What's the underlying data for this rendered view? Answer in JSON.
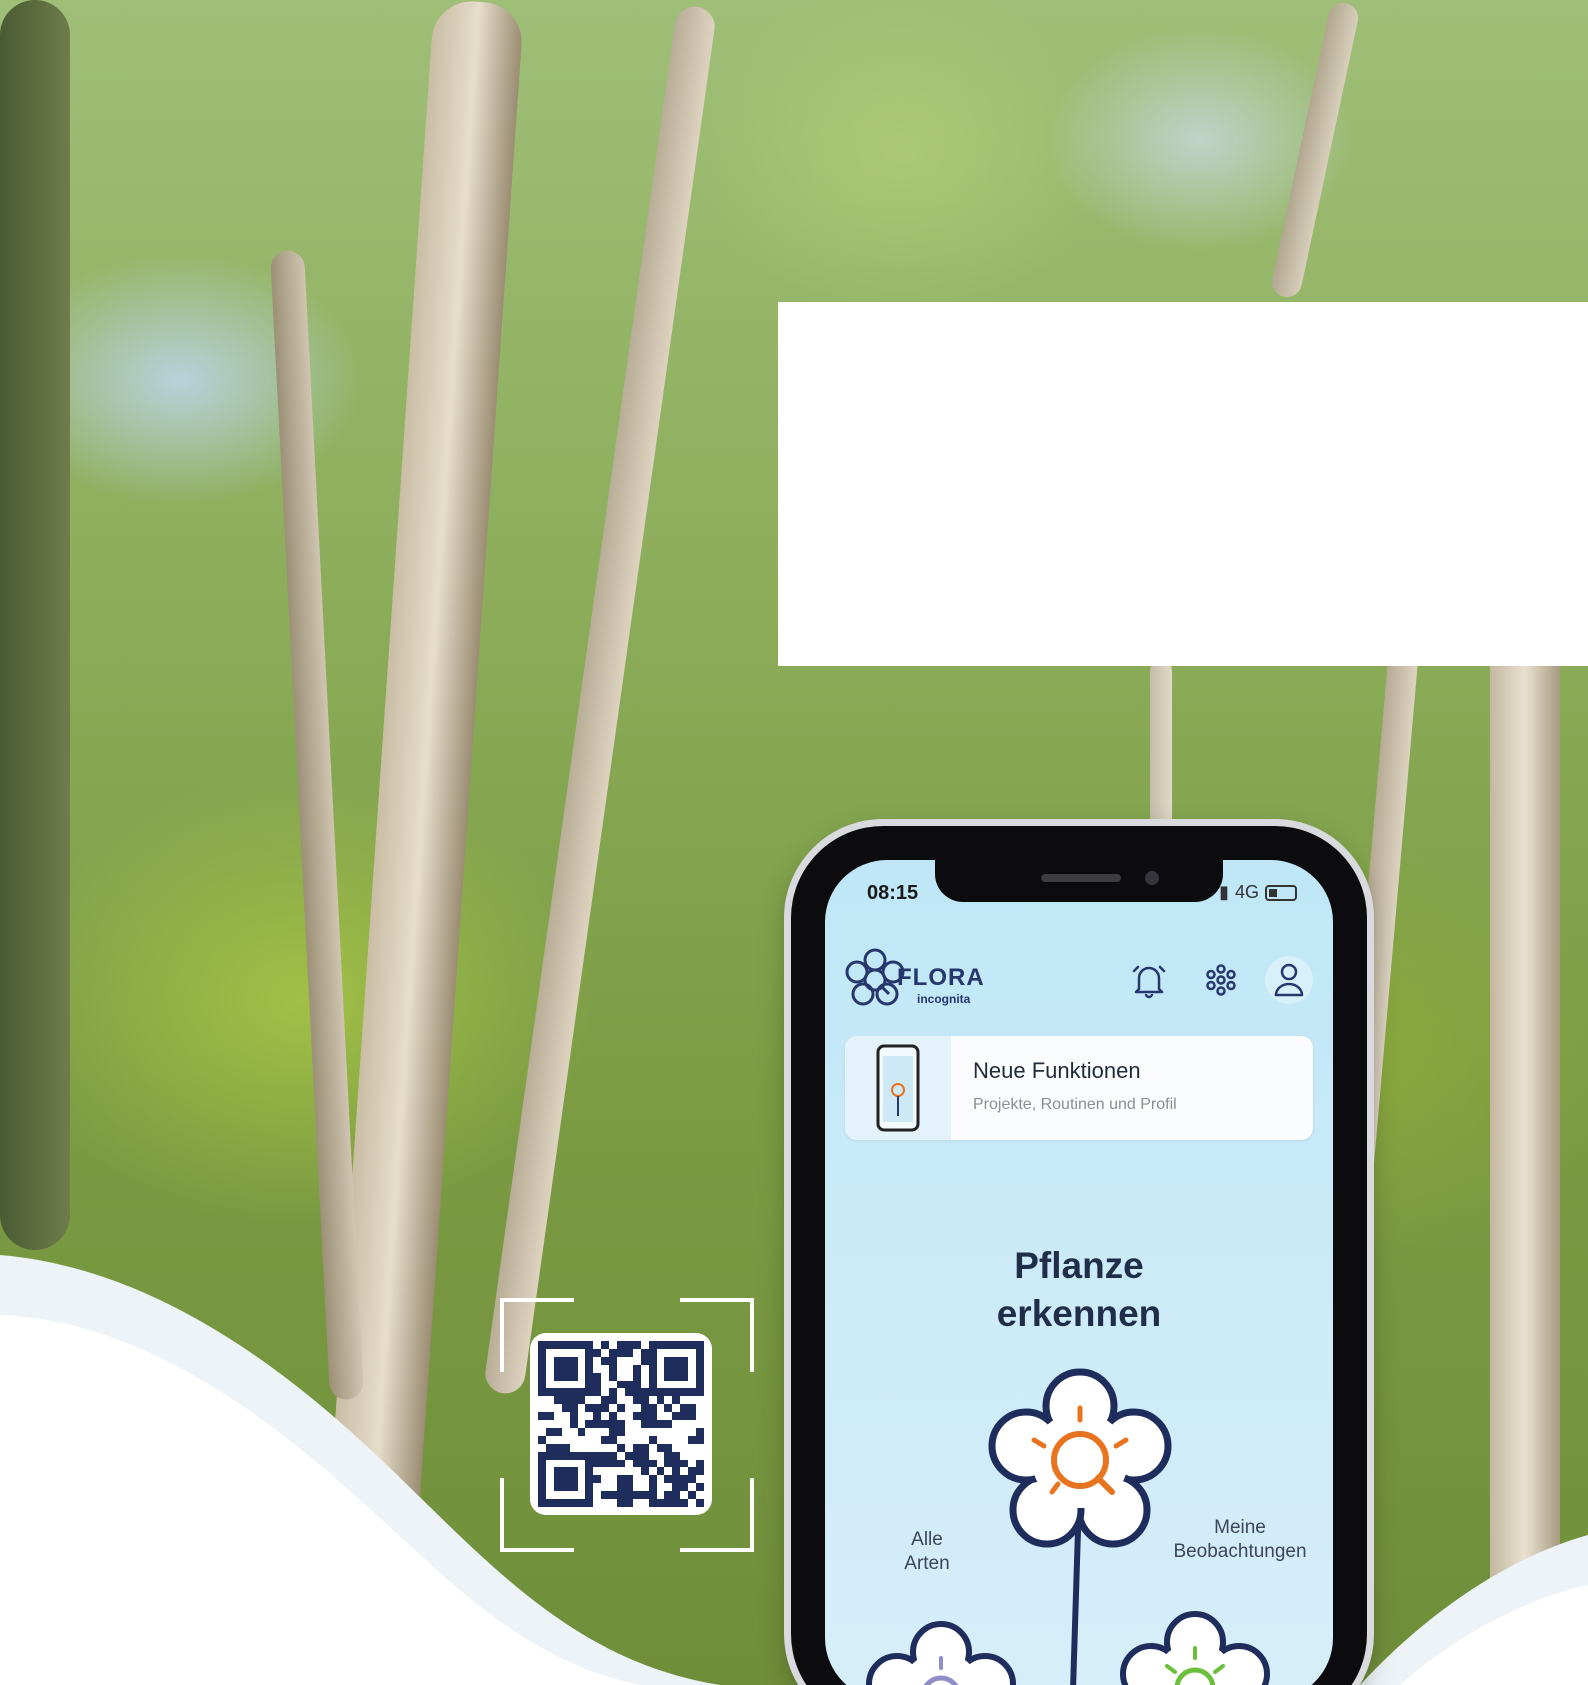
{
  "status_bar": {
    "time": "08:15",
    "network": "4G"
  },
  "app": {
    "logo_title": "FLORA",
    "logo_subtitle": "incognita"
  },
  "header_icons": [
    "bell-icon",
    "flower-dots-icon",
    "profile-icon"
  ],
  "news_card": {
    "title": "Neue Funktionen",
    "subtitle": "Projekte, Routinen und Profil"
  },
  "main": {
    "cta_line1": "Pflanze",
    "cta_line2": "erkennen",
    "left_label_line1": "Alle",
    "left_label_line2": "Arten",
    "right_label_line1": "Meine",
    "right_label_line2": "Beobachtungen"
  },
  "colors": {
    "accent_orange": "#e8741f",
    "brand_navy": "#1e2d5c",
    "accent_green": "#6cbf3a",
    "accent_purple": "#8f8ec9",
    "screen_bg": "#c6e9f8"
  }
}
